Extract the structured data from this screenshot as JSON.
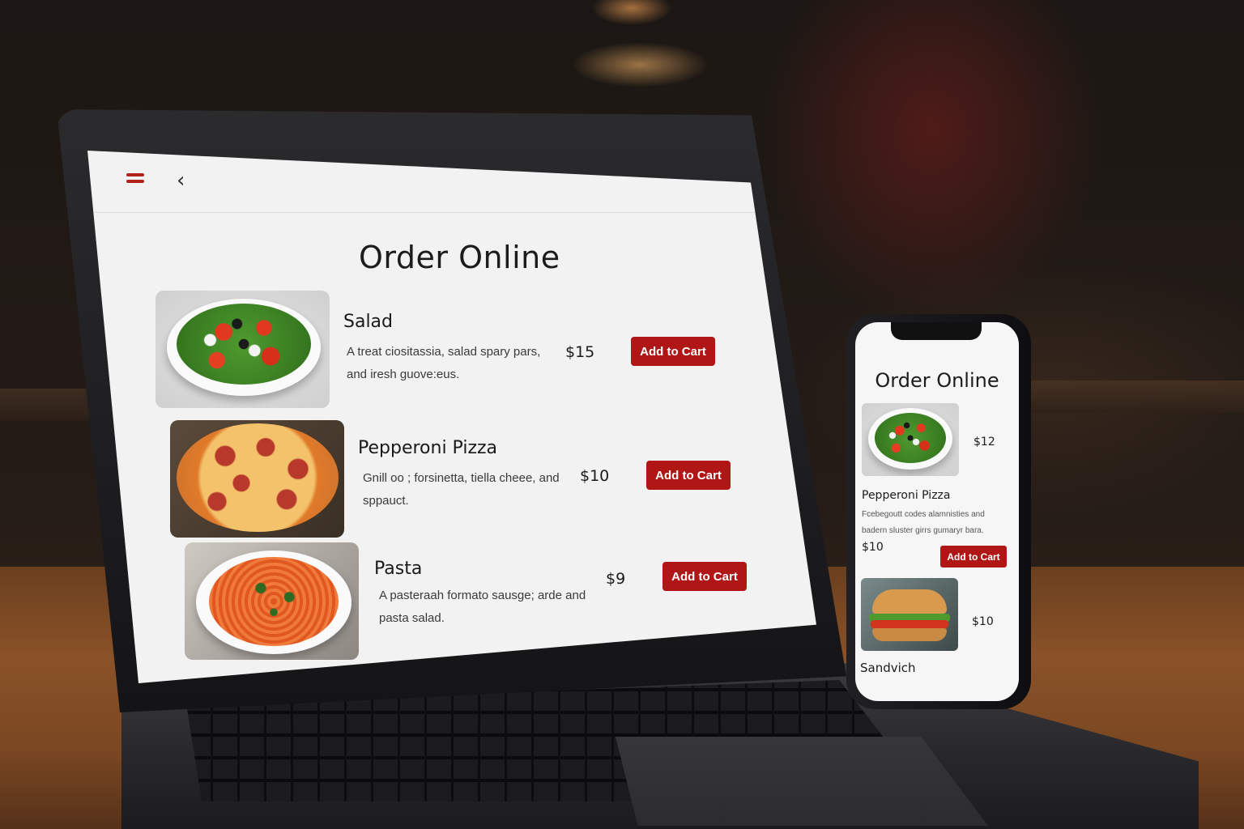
{
  "laptop": {
    "title": "Order Online",
    "menu_items": [
      {
        "name": "Salad",
        "description": "A treat ciositassia, salad spary pars, and iresh guove:eus.",
        "price": "$15",
        "button": "Add to Cart"
      },
      {
        "name": "Pepperoni Pizza",
        "description": "Gnill oo ; forsinetta, tiella cheee, and sppauct.",
        "price": "$10",
        "button": "Add to Cart"
      },
      {
        "name": "Pasta",
        "description": "A pasteraah formato sausge; arde and pasta salad.",
        "price": "$9",
        "button": "Add to Cart"
      }
    ]
  },
  "phone": {
    "title": "Order Online",
    "items": [
      {
        "name": "",
        "price": "$12"
      },
      {
        "name": "Pepperoni Pizza",
        "description": "Fcebegoutt codes alamnisties and badern sluster girrs gumaryr bara.",
        "price": "$10",
        "button": "Add to Cart"
      },
      {
        "name": "Sandvich",
        "price": "$10"
      }
    ]
  },
  "colors": {
    "accent": "#b11616",
    "screen_bg": "#f2f2f3"
  },
  "icons": {
    "menu": "hamburger-icon",
    "back": "chevron-left-icon"
  }
}
